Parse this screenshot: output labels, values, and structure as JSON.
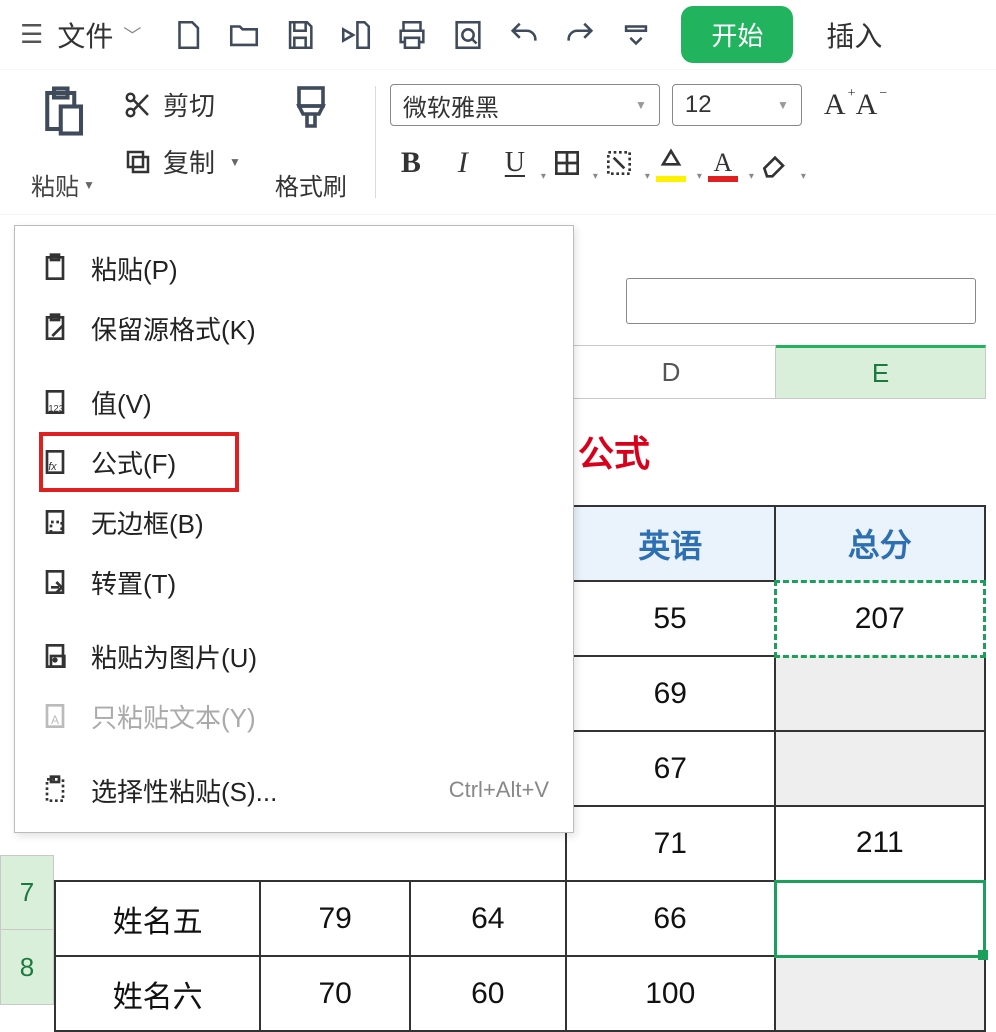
{
  "topbar": {
    "file_label": "文件",
    "start_button": "开始",
    "insert_label": "插入"
  },
  "ribbon": {
    "paste_label": "粘贴",
    "cut_label": "剪切",
    "copy_label": "复制",
    "format_brush": "格式刷",
    "font_name": "微软雅黑",
    "font_size": "12",
    "inc_font": "A",
    "dec_font": "A",
    "bold": "B",
    "italic": "I",
    "underline": "U"
  },
  "paste_menu": {
    "paste": "粘贴(P)",
    "keep_source": "保留源格式(K)",
    "values": "值(V)",
    "formulas": "公式(F)",
    "no_border": "无边框(B)",
    "transpose": "转置(T)",
    "as_picture": "粘贴为图片(U)",
    "text_only": "只粘贴文本(Y)",
    "special": "选择性粘贴(S)...",
    "special_shortcut": "Ctrl+Alt+V"
  },
  "columns": {
    "d": "D",
    "e": "E"
  },
  "title_fragment": "公式",
  "headers": {
    "english": "英语",
    "total": "总分"
  },
  "rows": {
    "r3": {
      "english": "55",
      "total": "207"
    },
    "r4": {
      "english": "69",
      "total": ""
    },
    "r5": {
      "english": "67",
      "total": ""
    },
    "r6": {
      "english": "71",
      "total": "211"
    },
    "r7": {
      "num": "7",
      "name": "姓名五",
      "c1": "79",
      "c2": "64",
      "english": "66",
      "total": ""
    },
    "r8": {
      "num": "8",
      "name": "姓名六",
      "c1": "70",
      "c2": "60",
      "english": "100",
      "total": ""
    }
  }
}
